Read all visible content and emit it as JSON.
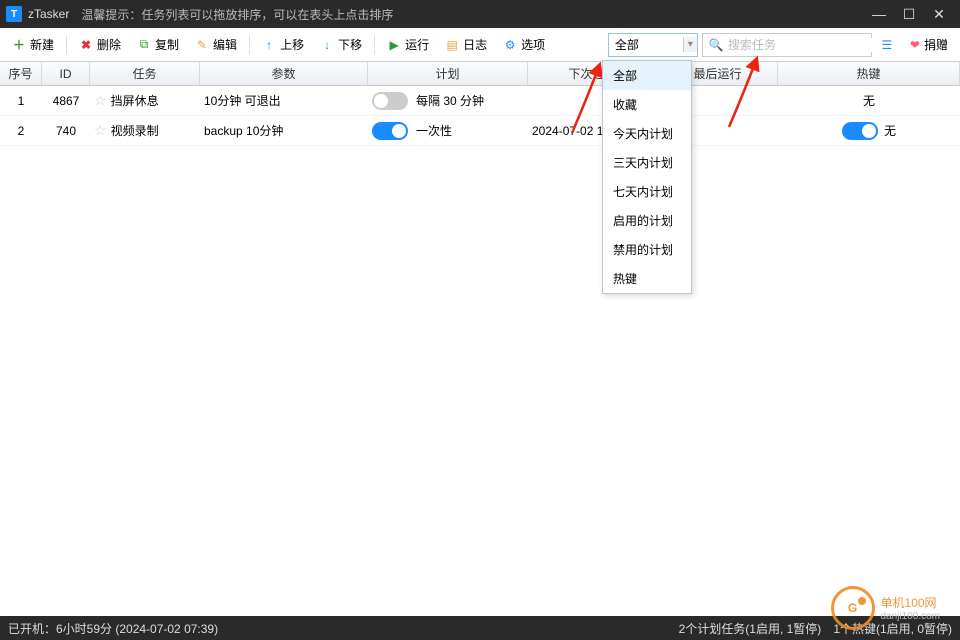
{
  "titlebar": {
    "app_name": "zTasker",
    "tip": "温馨提示：任务列表可以拖放排序，可以在表头上点击排序"
  },
  "toolbar": {
    "new": "新建",
    "delete": "删除",
    "copy": "复制",
    "edit": "编辑",
    "up": "上移",
    "down": "下移",
    "run": "运行",
    "log": "日志",
    "options": "选项",
    "filter_selected": "全部",
    "search_placeholder": "搜索任务",
    "donate": "捐赠"
  },
  "headers": {
    "seq": "序号",
    "id": "ID",
    "task": "任务",
    "param": "参数",
    "plan": "计划",
    "next": "下次运行",
    "last": "最后运行",
    "hotkey": "热键"
  },
  "rows": [
    {
      "seq": "1",
      "id": "4867",
      "task": "挡屏休息",
      "param": "10分钟 可退出",
      "enabled": false,
      "plan": "每隔 30 分钟",
      "next": "",
      "last": "",
      "hotkey": "无",
      "hk_toggle": false
    },
    {
      "seq": "2",
      "id": "740",
      "task": "视频录制",
      "param": "backup 10分钟",
      "enabled": true,
      "plan": "一次性",
      "next": "2024-07-02 18:30",
      "last": "",
      "hotkey": "无",
      "hk_toggle": true
    }
  ],
  "dropdown": {
    "items": [
      "全部",
      "收藏",
      "今天内计划",
      "三天内计划",
      "七天内计划",
      "启用的计划",
      "禁用的计划",
      "热键"
    ]
  },
  "statusbar": {
    "uptime": "已开机：6小时59分 (2024-07-02 07:39)",
    "tasks": "2个计划任务(1启用, 1暂停)",
    "hotkeys": "1个热键(1启用, 0暂停)"
  },
  "watermark": {
    "logo": "G",
    "name": "单机100网",
    "url": "danji100.com"
  }
}
